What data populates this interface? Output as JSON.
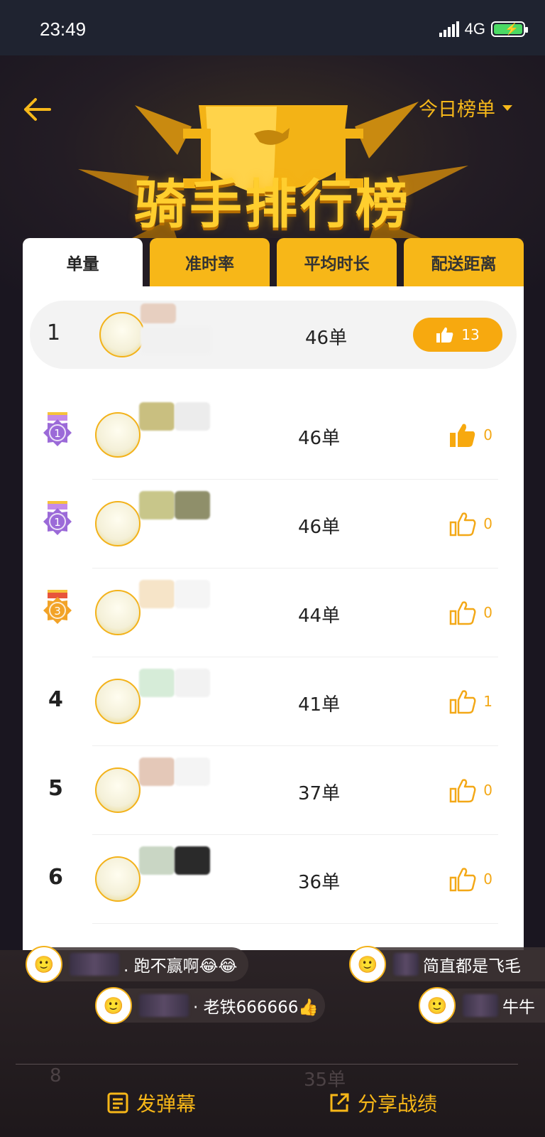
{
  "status": {
    "time": "23:49",
    "network": "4G"
  },
  "header": {
    "title": "骑手排行榜",
    "range_label": "今日榜单"
  },
  "tabs": [
    {
      "label": "单量",
      "active": true
    },
    {
      "label": "准时率",
      "active": false
    },
    {
      "label": "平均时长",
      "active": false
    },
    {
      "label": "配送距离",
      "active": false
    }
  ],
  "my_row": {
    "rank": "1",
    "count": "46单",
    "likes": "13"
  },
  "rows": [
    {
      "rank": "1",
      "medal": "purple",
      "count": "46单",
      "likes": "0",
      "liked": true
    },
    {
      "rank": "1",
      "medal": "purple",
      "count": "46单",
      "likes": "0",
      "liked": false
    },
    {
      "rank": "3",
      "medal": "gold",
      "count": "44单",
      "likes": "0",
      "liked": false
    },
    {
      "rank": "4",
      "medal": "",
      "count": "41单",
      "likes": "1",
      "liked": false
    },
    {
      "rank": "5",
      "medal": "",
      "count": "37单",
      "likes": "0",
      "liked": false
    },
    {
      "rank": "6",
      "medal": "",
      "count": "36单",
      "likes": "0",
      "liked": false
    }
  ],
  "danmaku": [
    {
      "text": ". 跑不赢啊😂😂"
    },
    {
      "text": "简直都是飞毛"
    },
    {
      "text": "· 老铁666666👍"
    },
    {
      "text": "牛牛"
    }
  ],
  "ghost": {
    "rank": "8",
    "count": "35单"
  },
  "footer": {
    "send_label": "发弹幕",
    "share_label": "分享战绩"
  },
  "colors": {
    "accent": "#f7b718",
    "medal_purple": "#9b6ad8",
    "medal_gold": "#f2a327"
  }
}
